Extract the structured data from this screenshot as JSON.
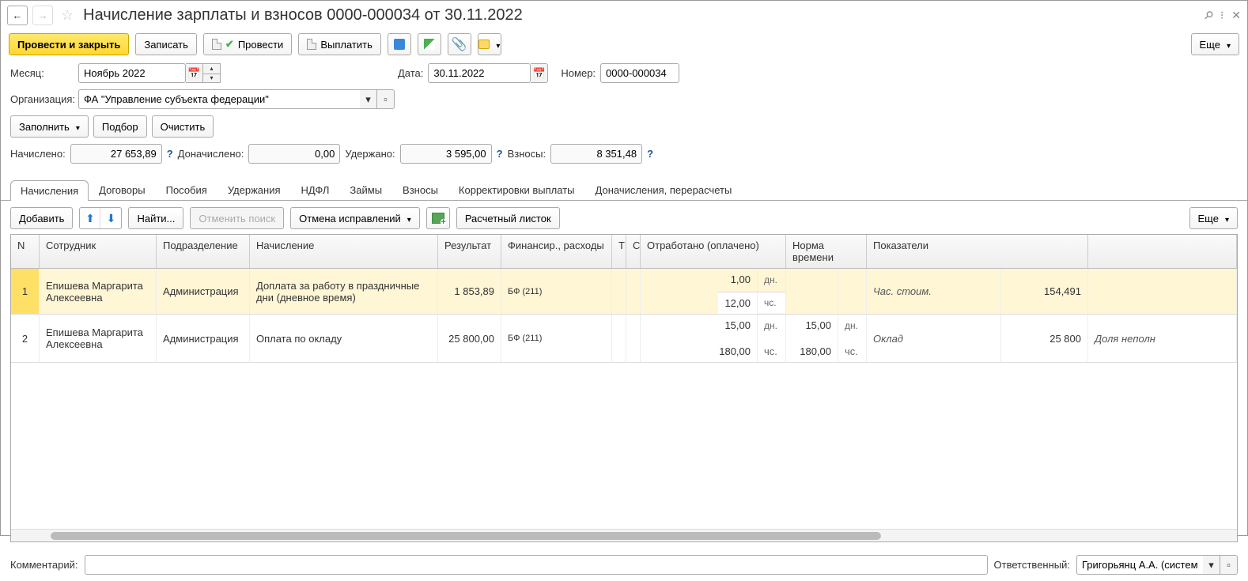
{
  "title": "Начисление зарплаты и взносов 0000-000034 от 30.11.2022",
  "toolbar": {
    "post_close": "Провести и закрыть",
    "save": "Записать",
    "post": "Провести",
    "pay": "Выплатить",
    "more": "Еще"
  },
  "form": {
    "month_label": "Месяц:",
    "month_value": "Ноябрь 2022",
    "date_label": "Дата:",
    "date_value": "30.11.2022",
    "number_label": "Номер:",
    "number_value": "0000-000034",
    "org_label": "Организация:",
    "org_value": "ФА \"Управление субъекта федерации\"",
    "fill": "Заполнить",
    "select": "Подбор",
    "clear": "Очистить",
    "accrued_label": "Начислено:",
    "accrued_value": "27 653,89",
    "added_label": "Доначислено:",
    "added_value": "0,00",
    "withheld_label": "Удержано:",
    "withheld_value": "3 595,00",
    "contrib_label": "Взносы:",
    "contrib_value": "8 351,48"
  },
  "tabs": {
    "accruals": "Начисления",
    "contracts": "Договоры",
    "benefits": "Пособия",
    "deductions": "Удержания",
    "ndfl": "НДФЛ",
    "loans": "Займы",
    "contributions": "Взносы",
    "corrections": "Корректировки выплаты",
    "recalcs": "Доначисления, перерасчеты"
  },
  "subtoolbar": {
    "add": "Добавить",
    "find": "Найти...",
    "cancel_search": "Отменить поиск",
    "undo_fix": "Отмена исправлений",
    "payslip": "Расчетный листок",
    "more": "Еще"
  },
  "grid": {
    "columns": {
      "n": "N",
      "employee": "Сотрудник",
      "department": "Подразделение",
      "accrual": "Начисление",
      "result": "Результат",
      "finance": "Финансир., расходы",
      "t": "Т",
      "c": "С",
      "worked": "Отработано (оплачено)",
      "norm": "Норма времени",
      "indicators": "Показатели"
    },
    "units": {
      "days": "дн.",
      "hours": "чс."
    },
    "rows": [
      {
        "n": "1",
        "employee": "Епишева Маргарита Алексеевна",
        "department": "Администрация",
        "accrual": "Доплата за работу в праздничные дни (дневное время)",
        "result": "1 853,89",
        "finance": "БФ (211)",
        "worked_days": "1,00",
        "worked_hours": "12,00",
        "norm_days": "",
        "norm_hours": "",
        "indicator_name": "Час. стоим.",
        "indicator_value": "154,491",
        "extra": ""
      },
      {
        "n": "2",
        "employee": "Епишева Маргарита Алексеевна",
        "department": "Администрация",
        "accrual": "Оплата по окладу",
        "result": "25 800,00",
        "finance": "БФ (211)",
        "worked_days": "15,00",
        "worked_hours": "180,00",
        "norm_days": "15,00",
        "norm_hours": "180,00",
        "indicator_name": "Оклад",
        "indicator_value": "25 800",
        "extra": "Доля неполн"
      }
    ]
  },
  "bottom": {
    "comment_label": "Комментарий:",
    "comment_value": "",
    "responsible_label": "Ответственный:",
    "responsible_value": "Григорьянц А.А. (системн"
  }
}
